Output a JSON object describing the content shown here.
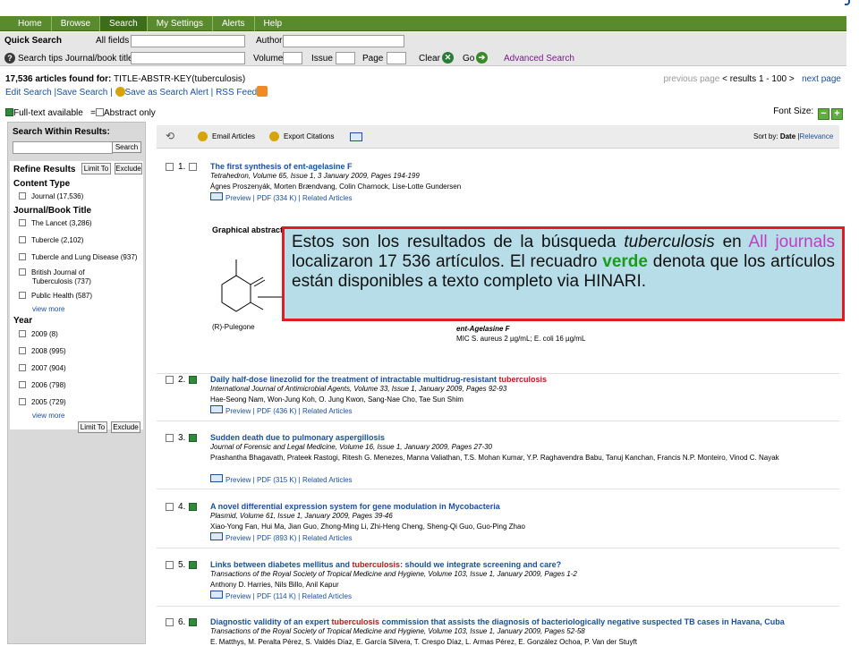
{
  "nav": {
    "tabs": [
      "Home",
      "Browse",
      "Search",
      "My Settings",
      "Alerts",
      "Help"
    ],
    "active": "Search"
  },
  "quick_search": {
    "title": "Quick Search",
    "all_fields_label": "All fields",
    "author_label": "Author",
    "search_tips_label": "Search tips",
    "journal_label": "Journal/book title",
    "volume_label": "Volume",
    "issue_label": "Issue",
    "page_label": "Page",
    "clear_label": "Clear",
    "go_label": "Go",
    "advanced_label": "Advanced Search"
  },
  "results_header": {
    "count_label": "17,536 articles found for:",
    "query": "TITLE-ABSTR-KEY(tuberculosis)",
    "edit_search": "Edit Search",
    "save_search": "Save Search",
    "save_alert": "Save as Search Alert",
    "rss_feed": "RSS Feed",
    "previous_page": "previous page",
    "results_range": "< results 1 - 100 >",
    "next_page": "next page"
  },
  "legend": {
    "full_text": "Full-text available",
    "abstract_only": "Abstract only",
    "font_size_label": "Font Size:"
  },
  "sidebar": {
    "search_within_title": "Search Within Results:",
    "search_button": "Search",
    "refine_title": "Refine Results",
    "limit_to": "Limit To",
    "exclude": "Exclude",
    "content_type_title": "Content Type",
    "content_type_items": [
      "Journal (17,536)"
    ],
    "journal_title": "Journal/Book Title",
    "journal_items": [
      "The Lancet (3,286)",
      "Tubercle (2,102)",
      "Tubercle and Lung Disease (937)",
      "British Journal of",
      "Tuberculosis (737)",
      "Public Health (587)"
    ],
    "view_more": "view more",
    "year_title": "Year",
    "year_items": [
      "2009 (8)",
      "2008 (995)",
      "2007 (904)",
      "2006 (798)",
      "2005 (729)"
    ]
  },
  "toolbar": {
    "email_articles": "Email Articles",
    "export_citations": "Export Citations",
    "sort_by_label": "Sort by:",
    "sort_date": "Date",
    "sort_relevance": "Relevance"
  },
  "results": [
    {
      "num": "1.",
      "title": "The first synthesis of ent-agelasine F",
      "source": "Tetrahedron, Volume 65, Issue 1, 3 January 2009, Pages 194-199",
      "authors": "Ágnes Proszenyák, Morten Brændvang, Colin Charnock, Lise-Lotte Gundersen",
      "links": "Preview | PDF (334 K) | Related Articles",
      "full_text": false
    },
    {
      "num": "2.",
      "title_pre": "Daily half-dose linezolid for the treatment of intractable multidrug-resistant ",
      "title_hl": "tuberculosis",
      "title_post": "",
      "source": "International Journal of Antimicrobial Agents, Volume 33, Issue 1, January 2009, Pages 92-93",
      "authors": "Hae-Seong Nam, Won-Jung Koh, O. Jung Kwon, Sang-Nae Cho, Tae Sun Shim",
      "links": "Preview | PDF (436 K) | Related Articles",
      "full_text": true
    },
    {
      "num": "3.",
      "title": "Sudden death due to pulmonary aspergillosis",
      "source": "Journal of Forensic and Legal Medicine, Volume 16, Issue 1, January 2009, Pages 27-30",
      "authors": "Prashantha Bhagavath, Prateek Rastogi, Ritesh G. Menezes, Manna Valiathan, T.S. Mohan Kumar, Y.P. Raghavendra Babu, Tanuj Kanchan, Francis N.P. Monteiro, Vinod C. Nayak",
      "links": "Preview | PDF (315 K) | Related Articles",
      "full_text": true
    },
    {
      "num": "4.",
      "title": "A novel differential expression system for gene modulation in Mycobacteria",
      "source": "Plasmid, Volume 61, Issue 1, January 2009, Pages 39-46",
      "authors": "Xiao-Yong Fan, Hui Ma, Jian Guo, Zhong-Ming Li, Zhi-Heng Cheng, Sheng-Qi Guo, Guo-Ping Zhao",
      "links": "Preview | PDF (893 K) | Related Articles",
      "full_text": true
    },
    {
      "num": "5.",
      "title_pre": "Links between diabetes mellitus and ",
      "title_hl": "tuberculosis",
      "title_post": ": should we integrate screening and care?",
      "source": "Transactions of the Royal Society of Tropical Medicine and Hygiene, Volume 103, Issue 1, January 2009, Pages 1-2",
      "authors": "Anthony D. Harries, Nils Billo, Anil Kapur",
      "links": "Preview | PDF (114 K) | Related Articles",
      "full_text": true
    },
    {
      "num": "6.",
      "title_pre": "Diagnostic validity of an expert ",
      "title_hl": "tuberculosis",
      "title_post": " commission that assists the diagnosis of bacteriologically negative suspected TB cases in Havana, Cuba",
      "source": "Transactions of the Royal Society of Tropical Medicine and Hygiene, Volume 103, Issue 1, January 2009, Pages 52-58",
      "authors": "E. Matthys, M. Peralta Pérez, S. Valdés Díaz, E. García Silvera, T. Crespo Díaz, L. Armas Pérez, E. González Ochoa, P. Van der Stuyft",
      "links": "",
      "full_text": true
    }
  ],
  "graphical_abstract": {
    "title": "Graphical abstract",
    "left_label": "(R)-Pulegone",
    "right_label": "ent-Agelasine F",
    "mic": "MIC S. aureus 2 µg/mL; E. coli 16 µg/mL"
  },
  "callout": {
    "part1": "Estos son los resultados de la búsqueda ",
    "term": "tuberculosis",
    "part2": " en ",
    "journals": "All journals",
    "part3": " localizaron  17 536 artículos. El recuadro ",
    "verde": "verde",
    "part4": " denota que los artículos están disponibles  a texto completo via HINARI."
  },
  "colors": {
    "nav_green": "#5a8a2e",
    "full_text_green": "#2f8a3a",
    "link_blue": "#1a4f9c",
    "highlight_red": "#c8121d",
    "callout_bg": "#b7dde8",
    "callout_border": "#e21b23"
  }
}
